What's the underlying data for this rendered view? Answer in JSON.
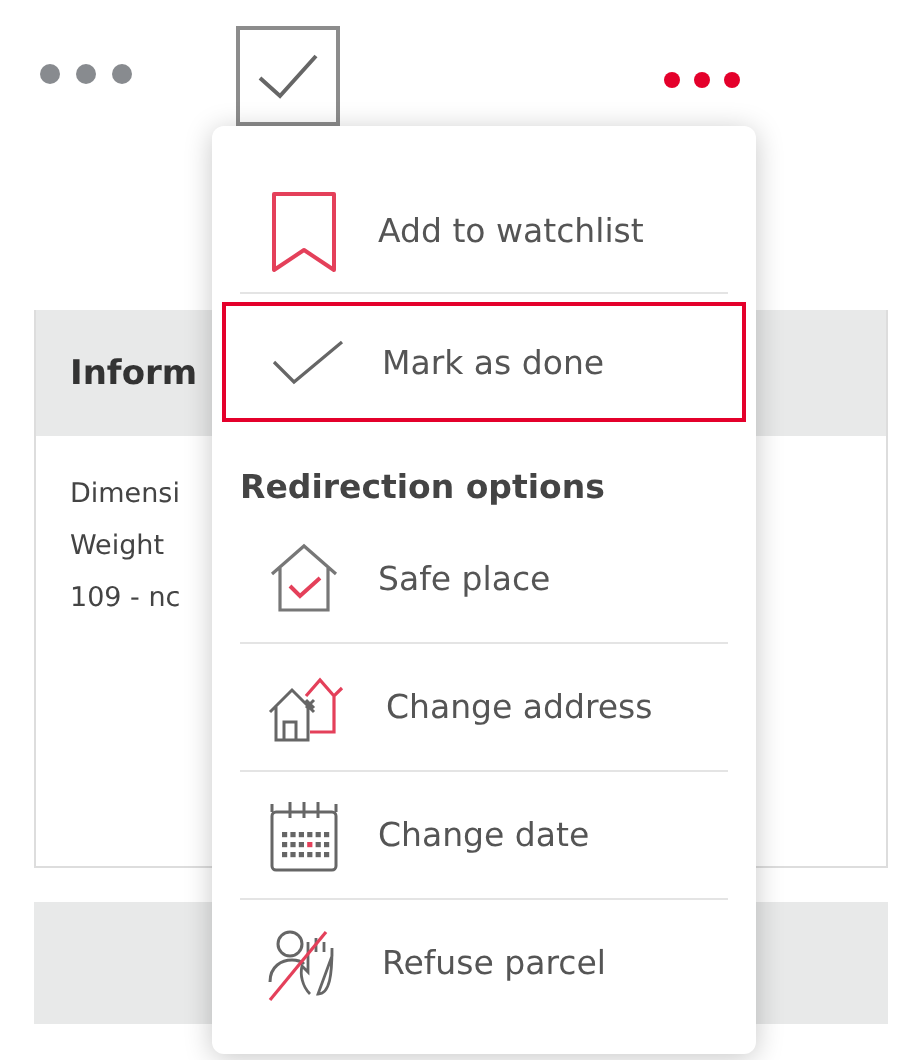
{
  "toolbar": {
    "done_checkbox": {
      "checked": true
    }
  },
  "info_card": {
    "header": "Inform",
    "lines": [
      "Dimensi",
      "Weight",
      "109 - nc"
    ]
  },
  "menu": {
    "items": [
      {
        "kind": "action",
        "label": "Add to watchlist",
        "selected": false
      },
      {
        "kind": "action",
        "label": "Mark as done",
        "selected": true
      },
      {
        "kind": "heading",
        "label": "Redirection options"
      },
      {
        "kind": "action",
        "label": "Safe place",
        "selected": false
      },
      {
        "kind": "action",
        "label": "Change address",
        "selected": false
      },
      {
        "kind": "action",
        "label": "Change date",
        "selected": false
      },
      {
        "kind": "action",
        "label": "Refuse parcel",
        "selected": false
      }
    ]
  }
}
